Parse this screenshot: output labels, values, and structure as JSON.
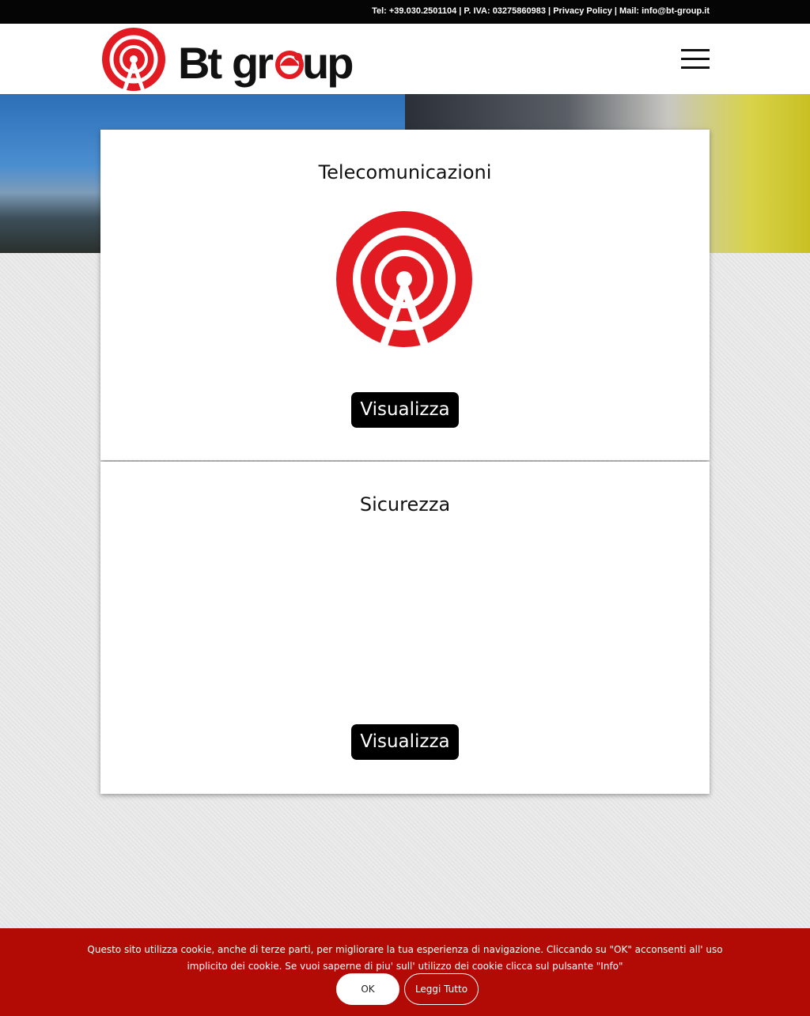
{
  "topbar": {
    "tel": "Tel: +39.030.2501104",
    "sep1": " | ",
    "piva": "P. IVA: 03275860983",
    "sep2": " | ",
    "privacy": "Privacy Policy",
    "sep3": " | ",
    "mail": "Mail: info@bt-group.it"
  },
  "brand": {
    "name": "Bt group",
    "accent": "#e21b23"
  },
  "cards": [
    {
      "title": "Telecomunicazioni",
      "button": "Visualizza"
    },
    {
      "title": "Sicurezza",
      "button": "Visualizza"
    }
  ],
  "cookie": {
    "message": "Questo sito utilizza cookie, anche di terze parti, per migliorare la tua esperienza di navigazione. Cliccando su \"OK\" acconsenti all' uso implicito dei cookie. Se vuoi saperne di piu' sull' utilizzo dei cookie clicca sul pulsante \"Info\"",
    "ok": "OK",
    "read_all": "Leggi Tutto",
    "bg": "#b20b06"
  },
  "icons": [
    "antenna-logo-icon",
    "hamburger-menu-icon"
  ]
}
